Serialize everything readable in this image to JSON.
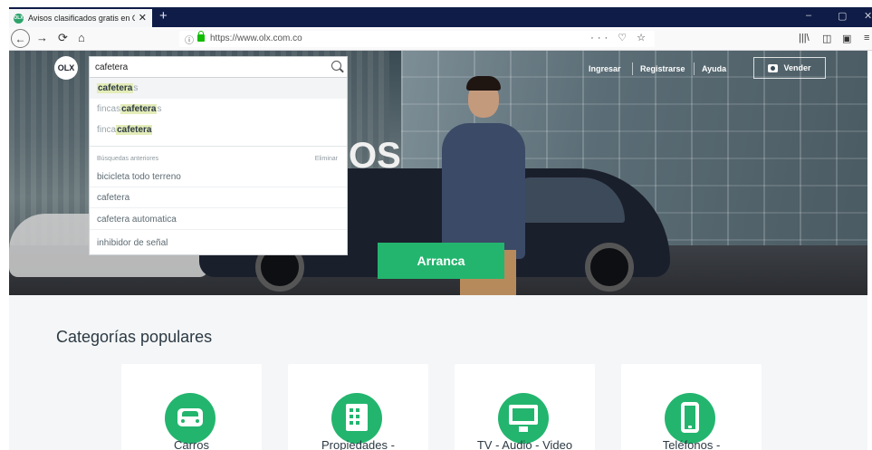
{
  "browser": {
    "tab_title": "Avisos clasificados gratis en Co",
    "tab_favicon": "OLX",
    "new_tab_icon": "plus-icon",
    "url": "https://www.olx.com.co",
    "url_actions": "··· ♡ ☆",
    "window_controls": [
      "–",
      "▢",
      "✕"
    ],
    "nav": {
      "back": "←",
      "forward": "→",
      "reload": "⟳",
      "home": "⌂"
    }
  },
  "header": {
    "logo": "OLX",
    "links": [
      "Ingresar",
      "Registrarse",
      "Ayuda"
    ],
    "sell_button": "Vender"
  },
  "search": {
    "query": "cafetera",
    "suggestions": [
      {
        "highlight": "cafetera",
        "prefix": "",
        "suffix": "s"
      },
      {
        "highlight": "cafetera",
        "prefix": "fincas ",
        "suffix": "s"
      },
      {
        "highlight": "cafetera",
        "prefix": "finca ",
        "suffix": ""
      }
    ],
    "recent_header": "Búsquedas anteriores",
    "clear_label": "Eliminar",
    "recent": [
      "bicicleta todo terreno",
      "cafetera",
      "cafetera automatica",
      "inhibidor de señal"
    ]
  },
  "hero": {
    "background_text": "OS",
    "cta_button": "Arranca"
  },
  "categories": {
    "title": "Categorías populares",
    "items": [
      {
        "label": "Carros",
        "icon": "car-icon"
      },
      {
        "label": "Propiedades -",
        "icon": "building-icon"
      },
      {
        "label": "TV - Audio - Video",
        "icon": "monitor-icon"
      },
      {
        "label": "Teléfonos -",
        "icon": "phone-icon"
      }
    ]
  },
  "colors": {
    "brand_green": "#23b56e",
    "highlight": "#e4ecb9",
    "tabbar": "#0f1c47"
  }
}
